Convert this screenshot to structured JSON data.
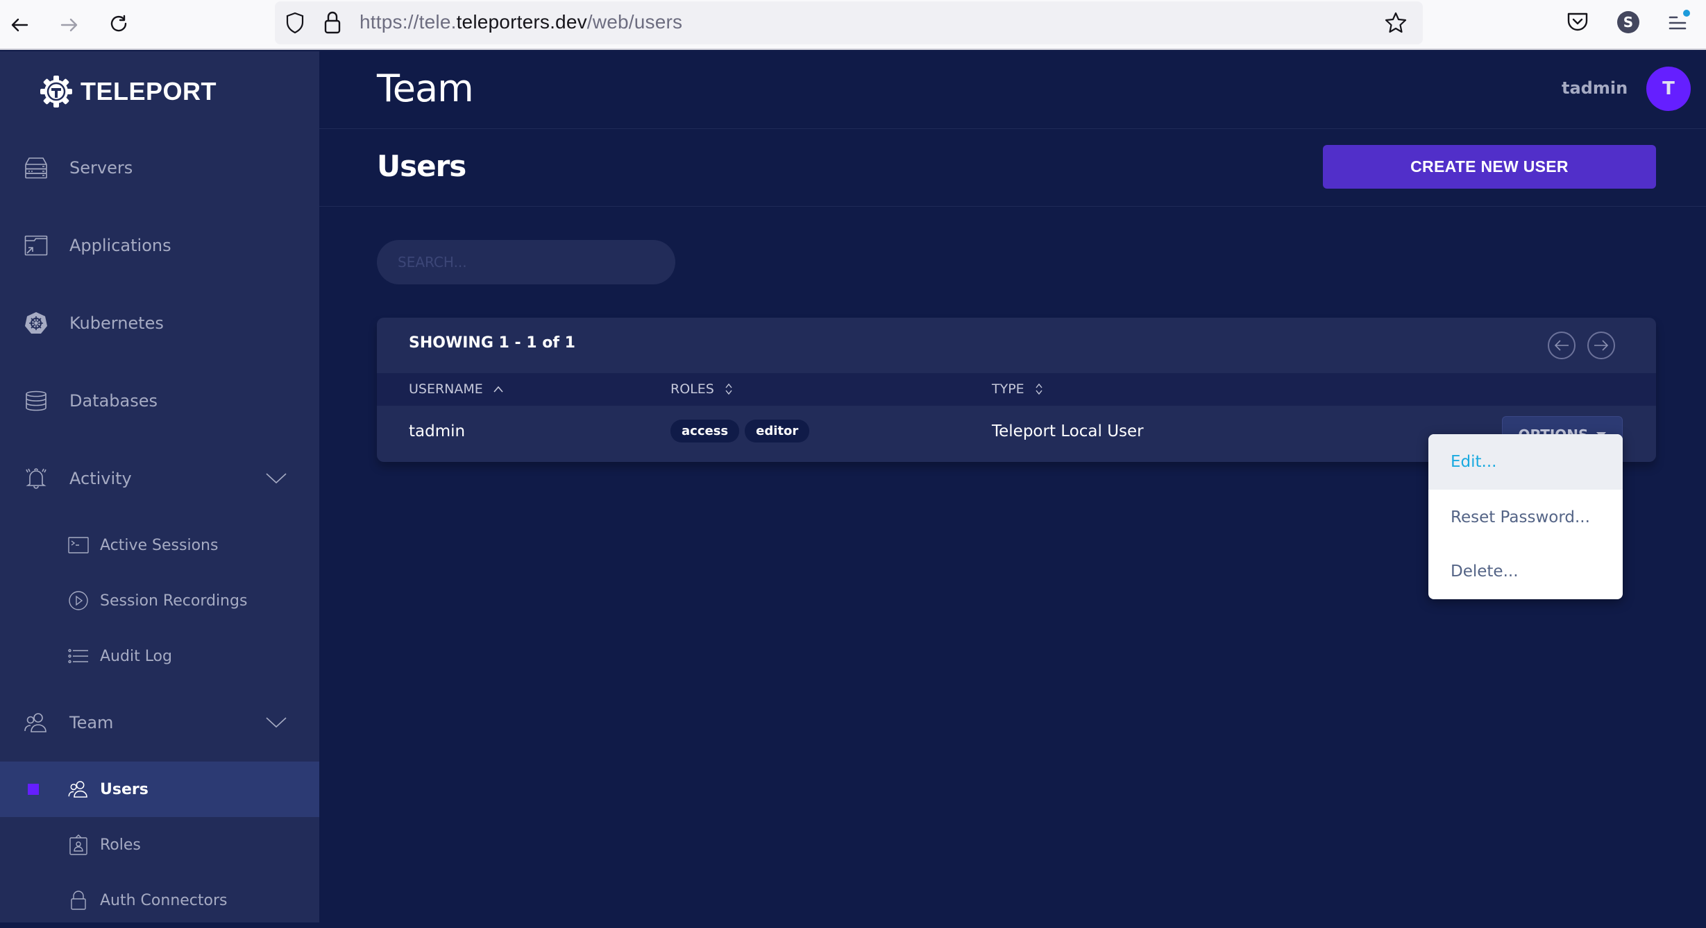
{
  "browser": {
    "url_prefix": "https://tele.",
    "url_host": "teleporters.dev",
    "url_path": "/web/users",
    "profile_initial": "S"
  },
  "sidebar": {
    "brand": "TELEPORT",
    "items": [
      {
        "label": "Servers",
        "icon": "server-icon"
      },
      {
        "label": "Applications",
        "icon": "application-icon"
      },
      {
        "label": "Kubernetes",
        "icon": "kubernetes-icon"
      },
      {
        "label": "Databases",
        "icon": "database-icon"
      },
      {
        "label": "Activity",
        "icon": "bell-icon",
        "expanded": true,
        "children": [
          {
            "label": "Active Sessions",
            "icon": "terminal-icon"
          },
          {
            "label": "Session Recordings",
            "icon": "play-icon"
          },
          {
            "label": "Audit Log",
            "icon": "list-icon"
          }
        ]
      },
      {
        "label": "Team",
        "icon": "users-icon",
        "expanded": true,
        "children": [
          {
            "label": "Users",
            "icon": "users-icon",
            "active": true
          },
          {
            "label": "Roles",
            "icon": "badge-icon"
          },
          {
            "label": "Auth Connectors",
            "icon": "lock-icon"
          }
        ]
      }
    ]
  },
  "header": {
    "title": "Team",
    "username": "tadmin",
    "avatar_initial": "T"
  },
  "page": {
    "subtitle": "Users",
    "create_button": "CREATE NEW USER",
    "search_placeholder": "SEARCH..."
  },
  "table": {
    "showing_prefix": "SHOWING ",
    "showing_range": "1 - 1 of 1",
    "columns": [
      {
        "label": "USERNAME",
        "sort": "asc"
      },
      {
        "label": "ROLES",
        "sort": "none"
      },
      {
        "label": "TYPE",
        "sort": "none"
      }
    ],
    "rows": [
      {
        "username": "tadmin",
        "roles": [
          "access",
          "editor"
        ],
        "type": "Teleport Local User",
        "action": "OPTIONS"
      }
    ]
  },
  "options_menu": {
    "items": [
      "Edit...",
      "Reset Password...",
      "Delete..."
    ],
    "hovered_index": 0
  },
  "colors": {
    "accent": "#651FFF",
    "button": "#512FC9",
    "sidebar_bg": "#222C59",
    "main_bg": "#101B48",
    "menu_hover_text": "#1AAAE0"
  }
}
